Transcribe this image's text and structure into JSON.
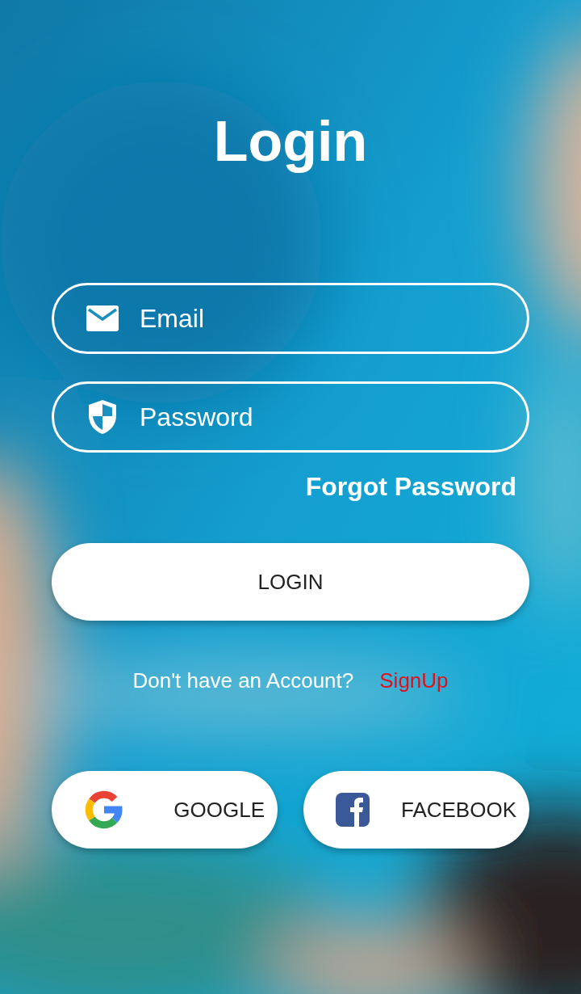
{
  "title": "Login",
  "fields": [
    {
      "kind": "email",
      "placeholder": "Email"
    },
    {
      "kind": "password",
      "placeholder": "Password"
    }
  ],
  "forgot_link": "Forgot Password",
  "login_button": "LOGIN",
  "signup_prompt": {
    "text": "Don't have an Account?",
    "link": "SignUp"
  },
  "social_buttons": [
    {
      "kind": "google",
      "label": "GOOGLE"
    },
    {
      "kind": "facebook",
      "label": "FACEBOOK"
    }
  ]
}
